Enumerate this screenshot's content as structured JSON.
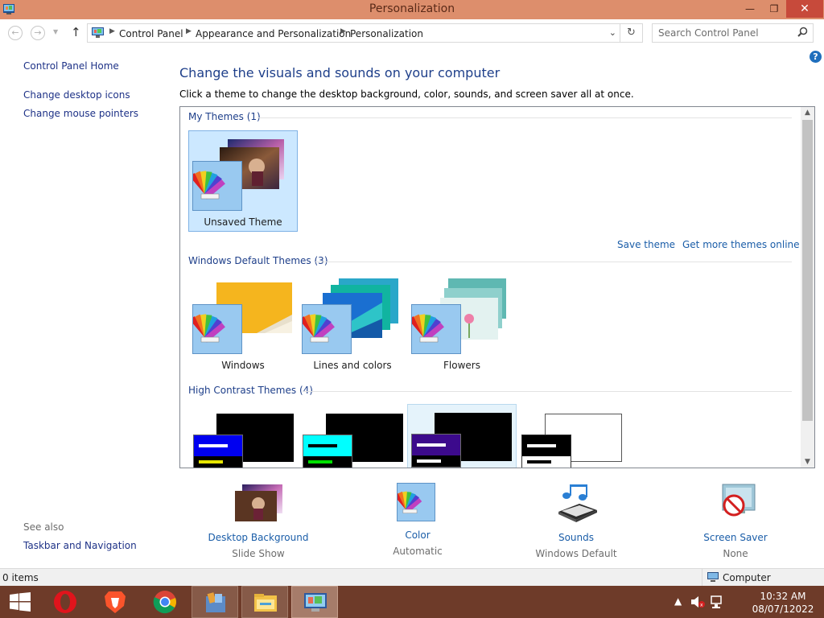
{
  "window": {
    "title": "Personalization"
  },
  "address": {
    "crumbs": [
      "Control Panel",
      "Appearance and Personalization",
      "Personalization"
    ],
    "search_placeholder": "Search Control Panel"
  },
  "left_pane": {
    "links": [
      "Control Panel Home",
      "Change desktop icons",
      "Change mouse pointers"
    ],
    "see_also_label": "See also",
    "see_also_links": [
      "Taskbar and Navigation"
    ]
  },
  "main": {
    "heading": "Change the visuals and sounds on your computer",
    "subheading": "Click a theme to change the desktop background, color, sounds, and screen saver all at once."
  },
  "themes": {
    "my_themes_title": "My Themes (1)",
    "my_themes": [
      {
        "label": "Unsaved Theme"
      }
    ],
    "save_theme_link": "Save theme",
    "get_more_link": "Get more themes online",
    "default_title": "Windows Default Themes (3)",
    "default_themes": [
      {
        "label": "Windows"
      },
      {
        "label": "Lines and colors"
      },
      {
        "label": "Flowers"
      }
    ],
    "high_contrast_title": "High Contrast Themes (4)"
  },
  "settings": [
    {
      "name": "Desktop Background",
      "value": "Slide Show",
      "icon": "wallpaper-icon"
    },
    {
      "name": "Color",
      "value": "Automatic",
      "icon": "color-palette-icon"
    },
    {
      "name": "Sounds",
      "value": "Windows Default",
      "icon": "music-notes-icon"
    },
    {
      "name": "Screen Saver",
      "value": "None",
      "icon": "screen-saver-icon"
    }
  ],
  "status": {
    "items": "0 items",
    "location": "Computer"
  },
  "taskbar": {
    "apps": [
      "start-icon",
      "opera-icon",
      "brave-icon",
      "chrome-icon",
      "store-icon",
      "file-explorer-icon",
      "control-panel-icon"
    ],
    "time": "10:32 AM",
    "date": "08/07/12022"
  },
  "colors": {
    "titlebar": "#dd8e6c",
    "taskbar": "#6e3b29",
    "link": "#1a5da8",
    "heading": "#1e3f8a"
  }
}
